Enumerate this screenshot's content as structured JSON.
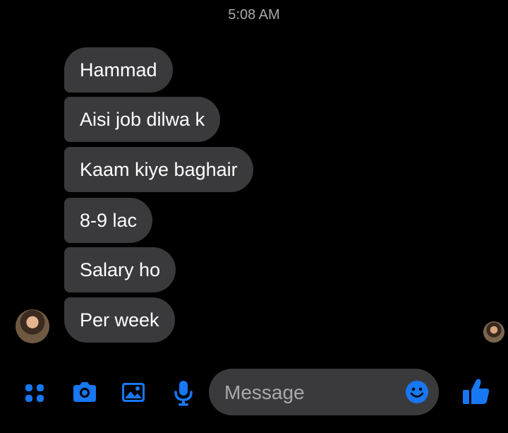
{
  "status": {
    "timestamp": "5:08 AM"
  },
  "messages": [
    {
      "text": "Hammad"
    },
    {
      "text": "Aisi job dilwa k"
    },
    {
      "text": "Kaam kiye baghair"
    },
    {
      "text": "8-9 lac"
    },
    {
      "text": "Salary ho"
    },
    {
      "text": "Per week"
    }
  ],
  "composer": {
    "placeholder": "Message"
  },
  "colors": {
    "accent": "#1877f2",
    "bubble": "#3a3a3c",
    "background": "#000000"
  },
  "icons": [
    "apps-icon",
    "camera-icon",
    "image-icon",
    "mic-icon",
    "emoji-icon",
    "thumbs-up-icon"
  ]
}
